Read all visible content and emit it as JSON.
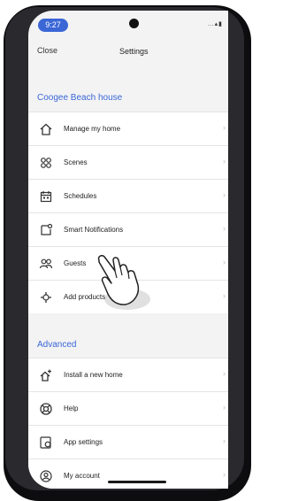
{
  "status_bar": {
    "time": "9:27",
    "icons": "…▴▮"
  },
  "nav": {
    "close_label": "Close",
    "title": "Settings"
  },
  "home_section": {
    "title": "Coogee Beach house",
    "items": [
      {
        "label": "Manage my home",
        "icon": "house-icon"
      },
      {
        "label": "Scenes",
        "icon": "scenes-icon"
      },
      {
        "label": "Schedules",
        "icon": "calendar-icon"
      },
      {
        "label": "Smart Notifications",
        "icon": "notification-icon"
      },
      {
        "label": "Guests",
        "icon": "guests-icon"
      },
      {
        "label": "Add products",
        "icon": "add-product-icon"
      }
    ]
  },
  "advanced_section": {
    "title": "Advanced",
    "items": [
      {
        "label": "Install a new home",
        "icon": "install-home-icon"
      },
      {
        "label": "Help",
        "icon": "help-icon"
      },
      {
        "label": "App settings",
        "icon": "app-settings-icon"
      },
      {
        "label": "My account",
        "icon": "account-icon"
      }
    ]
  },
  "chevron": "›",
  "colors": {
    "accent": "#3a66d6",
    "screen_bg": "#f3f3f4",
    "phone_frame": "#0d0d0f"
  }
}
